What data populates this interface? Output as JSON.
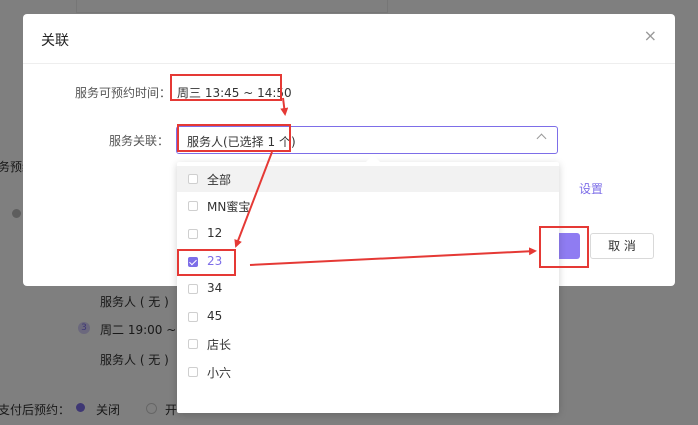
{
  "background": {
    "left_clipped_label": "务预约",
    "person_line_1": "服务人 ( 无 )",
    "slot_index": "3",
    "slot_time": "周二 19:00 ~ 2",
    "person_line_2": "服务人 ( 无 )",
    "pay_label": "支付后预约：",
    "radio_off_label": "关闭",
    "radio_on_label": "开"
  },
  "dialog": {
    "title": "关联",
    "close_icon": "close-icon",
    "time_label": "服务可预约时间：",
    "time_value": "周三 13:45 ~ 14:50",
    "relation_label": "服务关联：",
    "select_value": "服务人(已选择 1 个)",
    "settings_link": "设置",
    "ok_label": "",
    "cancel_label": "取 消"
  },
  "dropdown": {
    "options": [
      {
        "label": "全部",
        "checked": false
      },
      {
        "label": "MN蜜宝",
        "checked": false
      },
      {
        "label": "12",
        "checked": false
      },
      {
        "label": "23",
        "checked": true
      },
      {
        "label": "34",
        "checked": false
      },
      {
        "label": "45",
        "checked": false
      },
      {
        "label": "店长",
        "checked": false
      },
      {
        "label": "小六",
        "checked": false
      }
    ]
  },
  "colors": {
    "accent": "#7d6ee8",
    "annotation": "#e53935"
  }
}
